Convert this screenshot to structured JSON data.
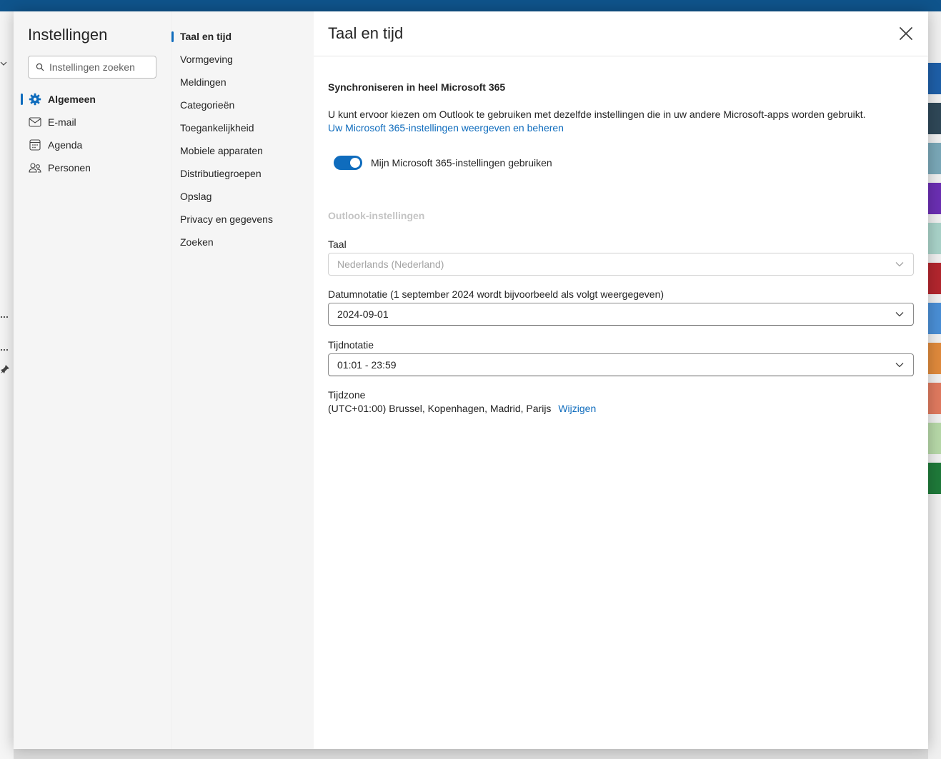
{
  "colors": {
    "accent": "#0f6cbd",
    "topbar": "#0f548c",
    "muted_text": "#c4c4c4"
  },
  "settings_nav": {
    "title": "Instellingen",
    "search_placeholder": "Instellingen zoeken",
    "items": [
      {
        "label": "Algemeen",
        "icon": "gear-icon",
        "active": true
      },
      {
        "label": "E-mail",
        "icon": "mail-icon",
        "active": false
      },
      {
        "label": "Agenda",
        "icon": "calendar-icon",
        "active": false
      },
      {
        "label": "Personen",
        "icon": "people-icon",
        "active": false
      }
    ]
  },
  "sub_nav": {
    "items": [
      {
        "label": "Taal en tijd",
        "active": true
      },
      {
        "label": "Vormgeving",
        "active": false
      },
      {
        "label": "Meldingen",
        "active": false
      },
      {
        "label": "Categorieën",
        "active": false
      },
      {
        "label": "Toegankelijkheid",
        "active": false
      },
      {
        "label": "Mobiele apparaten",
        "active": false
      },
      {
        "label": "Distributiegroepen",
        "active": false
      },
      {
        "label": "Opslag",
        "active": false
      },
      {
        "label": "Privacy en gegevens",
        "active": false
      },
      {
        "label": "Zoeken",
        "active": false
      }
    ]
  },
  "content": {
    "title": "Taal en tijd",
    "sync_title": "Synchroniseren in heel Microsoft 365",
    "sync_description": "U kunt ervoor kiezen om Outlook te gebruiken met dezelfde instellingen die in uw andere Microsoft-apps worden gebruikt.",
    "sync_link": "Uw Microsoft 365-instellingen weergeven en beheren",
    "toggle_label": "Mijn Microsoft 365-instellingen gebruiken",
    "toggle_on": true,
    "outlook_settings_title": "Outlook-instellingen",
    "language_label": "Taal",
    "language_value": "Nederlands (Nederland)",
    "date_format_label": "Datumnotatie (1 september 2024 wordt bijvoorbeeld als volgt weergegeven)",
    "date_format_value": "2024-09-01",
    "time_format_label": "Tijdnotatie",
    "time_format_value": "01:01 - 23:59",
    "timezone_label": "Tijdzone",
    "timezone_value": "(UTC+01:00) Brussel, Kopenhagen, Madrid, Parijs",
    "timezone_change": "Wijzigen"
  }
}
